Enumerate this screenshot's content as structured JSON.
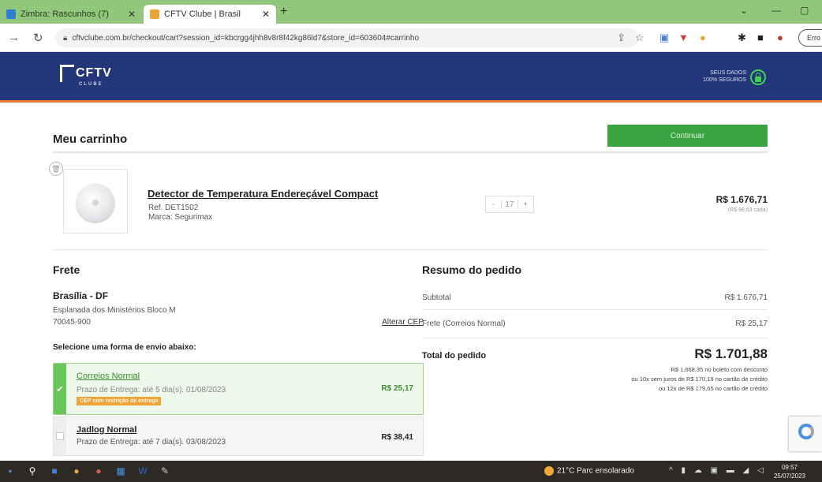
{
  "browser": {
    "tabs": [
      {
        "label": "Zimbra: Rascunhos (7)",
        "active": false
      },
      {
        "label": "CFTV Clube | Brasil",
        "active": true
      }
    ],
    "new_tab": "+",
    "url": "cftvclube.com.br/checkout/cart?session_id=kbcrgg4jhh8v8r8f42kg86ld7&store_id=603604#carrinho",
    "profile_label": "Erro"
  },
  "header": {
    "logo_text": "CFTV",
    "logo_sub": "CLUBE",
    "secure_line1": "SEUS DADOS",
    "secure_line2": "100% SEGUROS"
  },
  "cart": {
    "title": "Meu carrinho",
    "continue_label": "Continuar",
    "item": {
      "name": "Detector de Temperatura Endereçável Compact",
      "ref": "Ref. DET1502",
      "brand": "Marca: Segurimax",
      "qty": "17",
      "minus": "-",
      "plus": "+",
      "total": "R$ 1.676,71",
      "unit": "(R$ 98,63 cada)"
    }
  },
  "frete": {
    "title": "Frete",
    "city": "Brasília - DF",
    "address": "Esplanada dos Ministérios Bloco M",
    "cep": "70045-900",
    "alter_cep": "Alterar CEP",
    "select_label": "Selecione uma forma de envio abaixo:",
    "options": [
      {
        "name": "Correios Normal",
        "desc": "Prazo de Entrega: até 5 dia(s). 01/08/2023",
        "badge": "CEP com restrição de entrega",
        "price": "R$ 25,17",
        "selected": true
      },
      {
        "name": "Jadlog Normal",
        "desc": "Prazo de Entrega: até 7 dia(s). 03/08/2023",
        "price": "R$ 38,41",
        "selected": false
      }
    ]
  },
  "resumo": {
    "title": "Resumo do pedido",
    "subtotal_label": "Subtotal",
    "subtotal_value": "R$ 1.676,71",
    "frete_label": "Frete (Correios Normal)",
    "frete_value": "R$ 25,17",
    "total_label": "Total do pedido",
    "total_value": "R$ 1.701,88",
    "notes": [
      "R$ 1.668,35 no boleto com desconto",
      "ou 10x sem juros de R$ 170,19 no cartão de crédito",
      "ou 12x de R$ 179,65 no cartão de crédito"
    ]
  },
  "taskbar": {
    "weather": "21°C  Parc ensolarado",
    "time": "09:57",
    "date": "25/07/2023"
  }
}
